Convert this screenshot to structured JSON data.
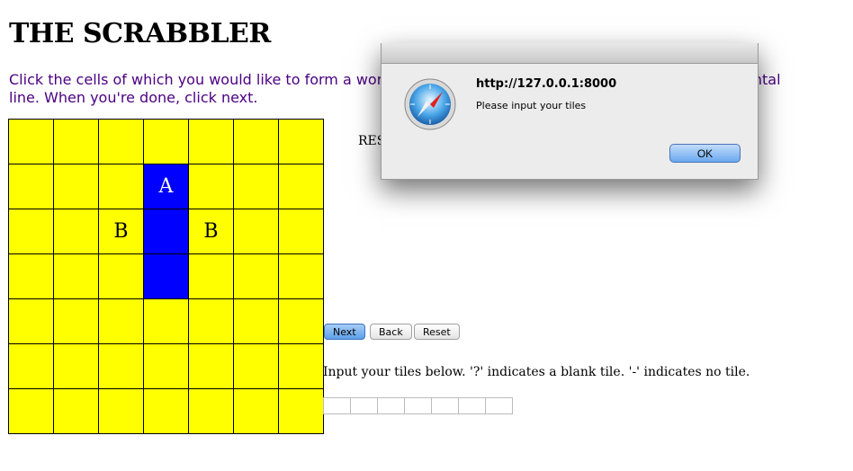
{
  "page": {
    "title": "THE SCRABBLER",
    "instructions": "Click the cells of which you would like to form a word. The cells you click must be in a vertical or horizontal line. When you're done, click next.",
    "result_label": "RESULT"
  },
  "board": {
    "rows": [
      [
        "",
        "",
        "",
        "",
        "",
        "",
        ""
      ],
      [
        "",
        "",
        "",
        "A",
        "",
        "",
        ""
      ],
      [
        "",
        "",
        "B",
        "",
        "B",
        "",
        ""
      ],
      [
        "",
        "",
        "",
        "",
        "",
        "",
        ""
      ],
      [
        "",
        "",
        "",
        "",
        "",
        "",
        ""
      ],
      [
        "",
        "",
        "",
        "",
        "",
        "",
        ""
      ],
      [
        "",
        "",
        "",
        "",
        "",
        "",
        ""
      ]
    ],
    "selected_cells": [
      [
        1,
        3
      ],
      [
        2,
        3
      ],
      [
        3,
        3
      ]
    ],
    "cell_color": "#ffff00",
    "selected_color": "#0000ff"
  },
  "buttons": {
    "next": "Next",
    "back": "Back",
    "reset": "Reset"
  },
  "tiles": {
    "label": "Input your tiles below. '?' indicates a blank tile. '-' indicates no tile.",
    "values": [
      "",
      "",
      "",
      "",
      "",
      "",
      ""
    ]
  },
  "dialog": {
    "title": "http://127.0.0.1:8000",
    "message": "Please input your tiles",
    "ok_label": "OK",
    "icon": "safari-compass-icon"
  }
}
